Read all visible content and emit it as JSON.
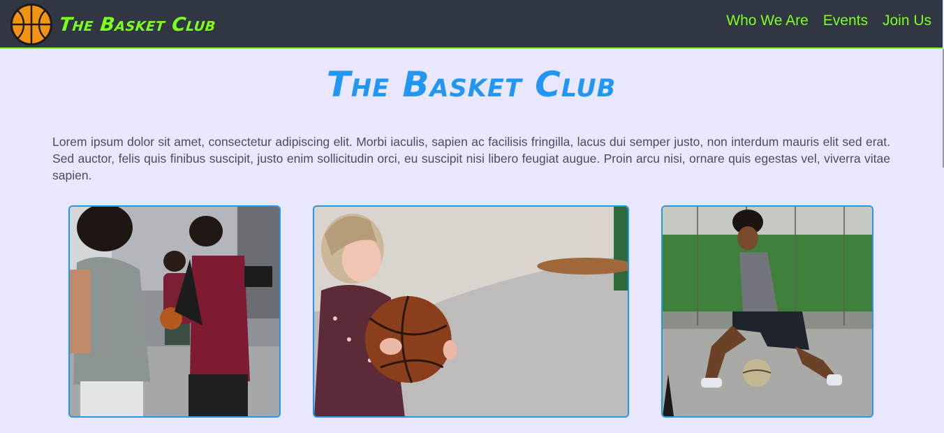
{
  "header": {
    "brand_name": "The Basket Club",
    "logo_icon": "basketball-icon",
    "nav": [
      {
        "label": "Who We Are"
      },
      {
        "label": "Events"
      },
      {
        "label": "Join Us"
      }
    ]
  },
  "main": {
    "title": "The Basket Club",
    "intro": "Lorem ipsum dolor sit amet, consectetur adipiscing elit. Morbi iaculis, sapien ac facilisis fringilla, lacus dui semper justo, non interdum mauris elit sed erat. Sed auctor, felis quis finibus suscipit, justo enim sollicitudin orci, eu suscipit nisi libero feugiat augue. Proin arcu nisi, ornare quis egestas vel, viverra vitae sapien."
  },
  "colors": {
    "navbar_bg": "#303642",
    "accent_green": "#7cff1f",
    "title_blue": "#2196f3",
    "page_bg": "#e9e6ff",
    "text": "#4a4e58"
  }
}
